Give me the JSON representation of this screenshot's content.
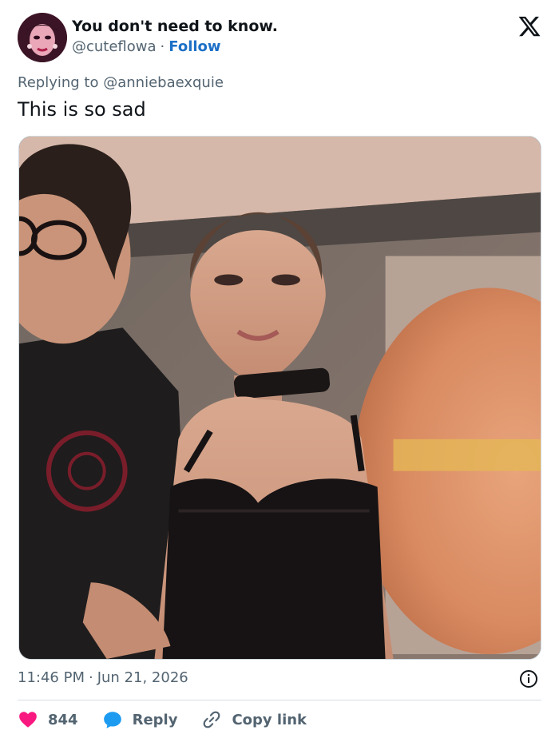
{
  "author": {
    "display_name": "You don't need to know.",
    "handle": "@cuteflowa",
    "separator": "·",
    "follow_label": "Follow"
  },
  "reply_context": {
    "prefix": "Replying to",
    "target": "@anniebaexquie"
  },
  "tweet": {
    "text": "This is so sad"
  },
  "meta": {
    "time": "11:46 PM",
    "separator": "·",
    "date": "Jun 21, 2026"
  },
  "actions": {
    "likes_count": "844",
    "reply_label": "Reply",
    "copy_label": "Copy link"
  },
  "icons": {
    "brand": "x-logo-icon",
    "like": "heart-icon",
    "reply": "speech-bubble-icon",
    "copy": "link-icon",
    "info": "info-icon"
  },
  "colors": {
    "text": "#0f1419",
    "muted": "#536471",
    "link": "#1d6fc6",
    "heart": "#f91880",
    "reply": "#1d9bf0"
  }
}
